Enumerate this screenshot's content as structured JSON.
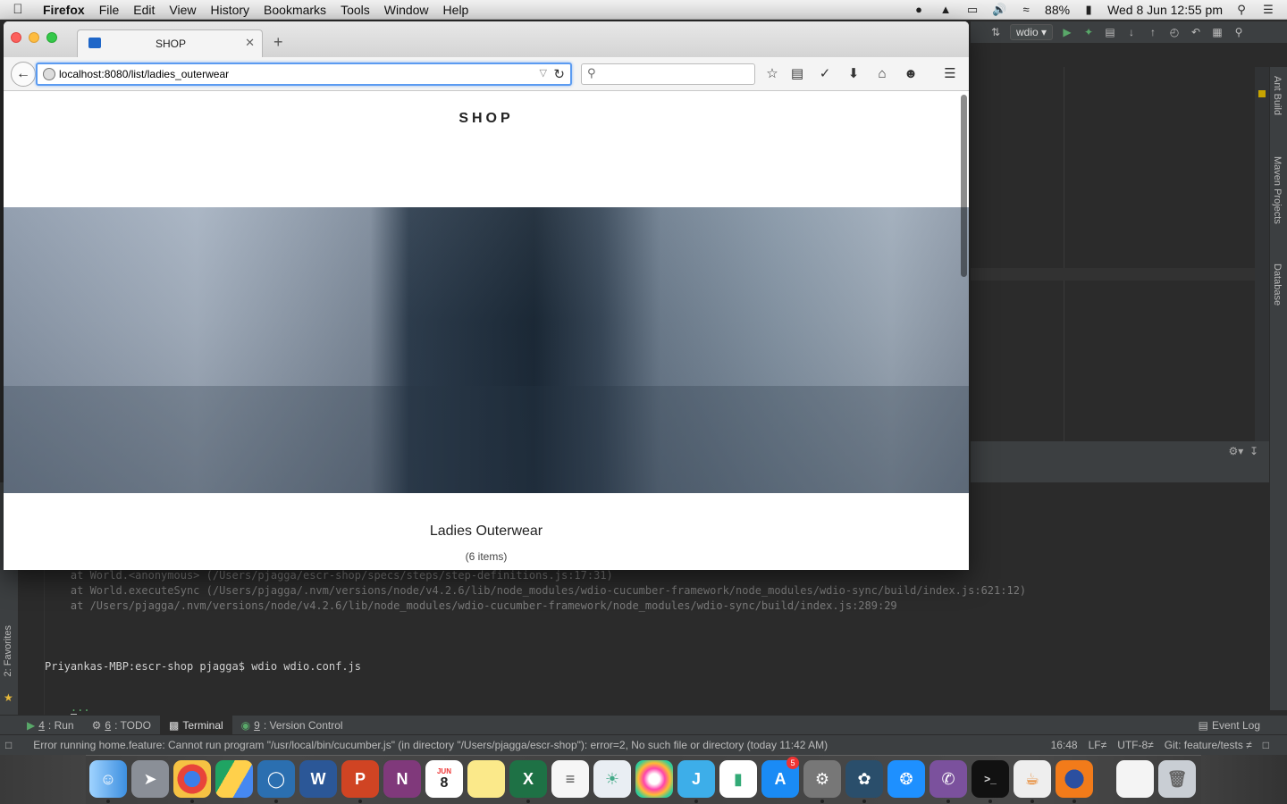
{
  "menubar": {
    "app": "Firefox",
    "items": [
      "File",
      "Edit",
      "View",
      "History",
      "Bookmarks",
      "Tools",
      "Window",
      "Help"
    ],
    "battery": "88%",
    "datetime": "Wed 8 Jun  12:55 pm"
  },
  "browser": {
    "tab_title": "SHOP",
    "url": "localhost:8080/list/ladies_outerwear",
    "search_placeholder": ""
  },
  "page": {
    "shop_title": "SHOP",
    "category_title": "Ladies Outerwear",
    "item_count": "(6 items)"
  },
  "ide": {
    "run_config": "wdio",
    "side_tabs": [
      "Ant Build",
      "Maven Projects",
      "Database"
    ],
    "left_tab": "2: Favorites",
    "terminal_lines": [
      "    at World.<anonymous> (/Users/pjagga/escr-shop/specs/steps/step-definitions.js:17:31)",
      "    at World.executeSync (/Users/pjagga/.nvm/versions/node/v4.2.6/lib/node_modules/wdio-cucumber-framework/node_modules/wdio-sync/build/index.js:621:12)",
      "    at /Users/pjagga/.nvm/versions/node/v4.2.6/lib/node_modules/wdio-cucumber-framework/node_modules/wdio-sync/build/index.js:289:29"
    ],
    "prompt": "Priyankas-MBP:escr-shop pjagga$ wdio wdio.conf.js",
    "progress": "...",
    "tool_tabs": [
      {
        "num": "4",
        "label": ": Run"
      },
      {
        "num": "6",
        "label": ": TODO"
      },
      {
        "num": "",
        "label": "Terminal"
      },
      {
        "num": "9",
        "label": ": Version Control"
      }
    ],
    "event_log": "Event Log",
    "status_message": "Error running home.feature: Cannot run program \"/usr/local/bin/cucumber.js\" (in directory \"/Users/pjagga/escr-shop\"): error=2, No such file or directory (today 11:42 AM)",
    "position": "16:48",
    "line_sep": "LF≠",
    "encoding": "UTF-8≠",
    "git": "Git: feature/tests ≠"
  },
  "dock": {
    "calendar_month": "JUN",
    "calendar_day": "8",
    "appstore_badge": "5"
  }
}
